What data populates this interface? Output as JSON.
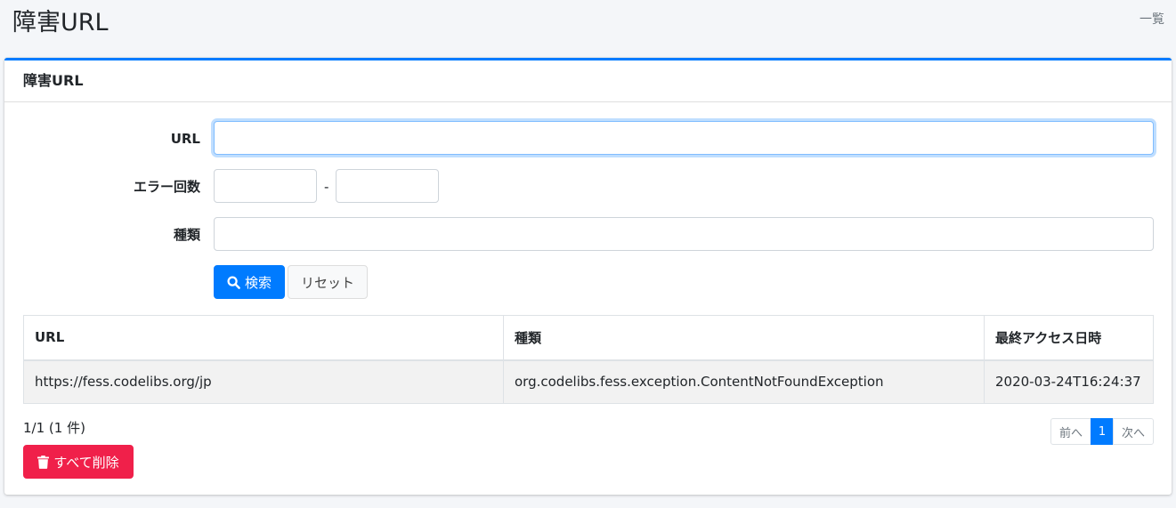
{
  "header": {
    "title": "障害URL",
    "breadcrumb": "一覧"
  },
  "card": {
    "title": "障害URL"
  },
  "form": {
    "url_label": "URL",
    "url_value": "",
    "error_count_label": "エラー回数",
    "error_min_value": "",
    "range_separator": "-",
    "error_max_value": "",
    "type_label": "種類",
    "type_value": "",
    "search_label": "検索",
    "reset_label": "リセット"
  },
  "table": {
    "columns": [
      "URL",
      "種類",
      "最終アクセス日時"
    ],
    "rows": [
      [
        "https://fess.codelibs.org/jp",
        "org.codelibs.fess.exception.ContentNotFoundException",
        "2020-03-24T16:24:37"
      ]
    ]
  },
  "count_text": "1/1 (1 件)",
  "pagination": {
    "prev": "前へ",
    "current": "1",
    "next": "次へ"
  },
  "delete_all_label": "すべて削除",
  "colors": {
    "primary": "#007bff",
    "danger": "#f0204a"
  }
}
